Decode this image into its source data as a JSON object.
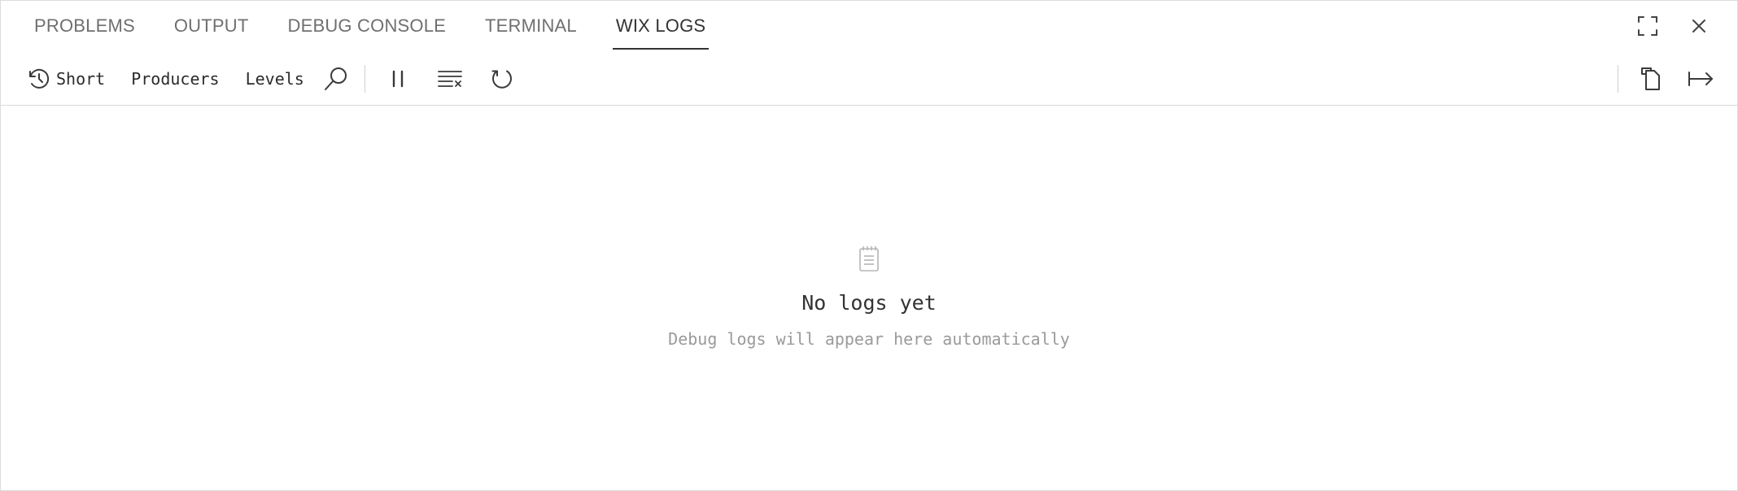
{
  "tabs": [
    {
      "label": "PROBLEMS"
    },
    {
      "label": "OUTPUT"
    },
    {
      "label": "DEBUG CONSOLE"
    },
    {
      "label": "TERMINAL"
    },
    {
      "label": "WIX LOGS",
      "active": true
    }
  ],
  "tab_actions": {
    "maximize_icon": "maximize-icon",
    "close_icon": "close-icon"
  },
  "toolbar": {
    "format_label": "Short",
    "format_icon": "history-icon",
    "producers_label": "Producers",
    "levels_label": "Levels",
    "search_icon": "search-icon",
    "pause_icon": "pause-icon",
    "clear_icon": "clear-all-icon",
    "refresh_icon": "refresh-icon",
    "copy_icon": "copy-icon",
    "wrap_icon": "word-wrap-icon"
  },
  "empty_state": {
    "icon": "notepad-icon",
    "title": "No logs yet",
    "subtitle": "Debug logs will appear here automatically"
  },
  "colors": {
    "active_tab": "#333333",
    "inactive_tab": "#6f6f6f",
    "muted_text": "#9a9a9a",
    "border": "#d9d9d9"
  }
}
